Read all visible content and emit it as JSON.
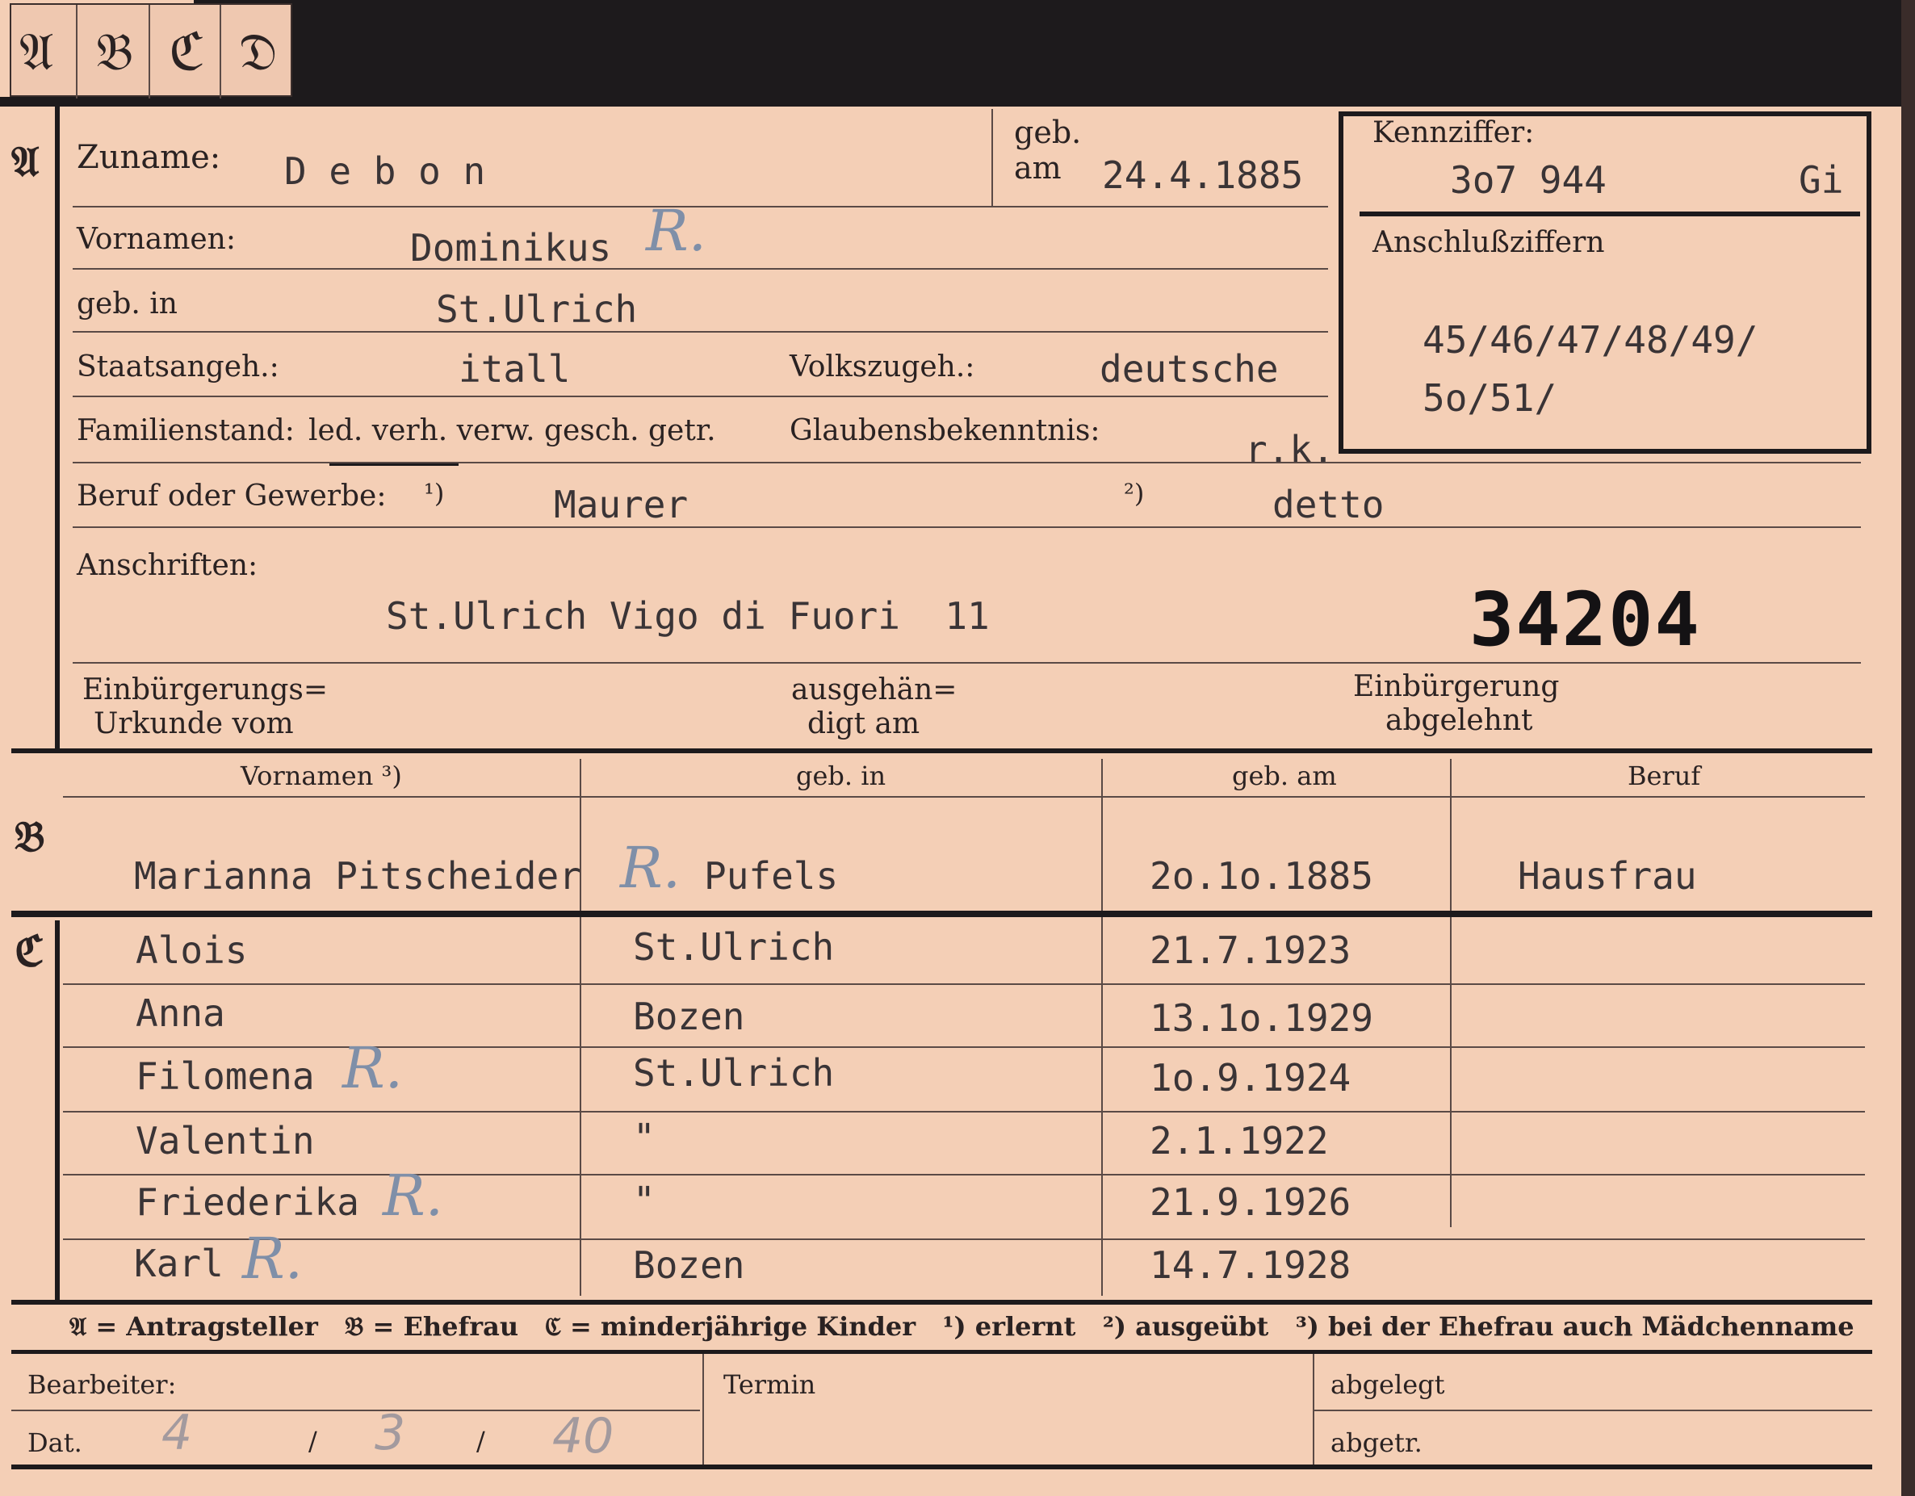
{
  "tabs": [
    "𝔄",
    "𝔅",
    "ℭ",
    "𝔇"
  ],
  "section_letters": {
    "a": "𝔄",
    "b": "𝔅",
    "c": "ℭ"
  },
  "section_a": {
    "surname_label": "Zuname:",
    "surname": "D e b o n",
    "born_label_1": "geb.",
    "born_label_2": "am",
    "birth_date": "24.4.1885",
    "given_names_label": "Vornamen:",
    "given_names": "Dominikus",
    "birthplace_label": "geb. in",
    "birthplace": "St.Ulrich",
    "citizenship_label": "Staatsangeh.:",
    "citizenship": "itall",
    "ethnicity_label": "Volkszugeh.:",
    "ethnicity": "deutsche",
    "marital_label": "Familienstand:",
    "marital_options": "led. verh. verw. gesch. getr.",
    "religion_label": "Glaubensbekenntnis:",
    "religion": "r.k.",
    "occupation_label": "Beruf oder Gewerbe:",
    "footnote_1": "¹)",
    "occupation_1": "Maurer",
    "footnote_2": "²)",
    "occupation_2": "detto",
    "address_label": "Anschriften:",
    "address": "St.Ulrich Vigo di Fuori  11",
    "stamp_number": "34204",
    "naturalization_label_1": "Einbürgerungs=",
    "naturalization_label_2": "Urkunde vom",
    "handed_label_1": "ausgehän=",
    "handed_label_2": "digt am",
    "rejected_label_1": "Einbürgerung",
    "rejected_label_2": "abgelehnt"
  },
  "id_box": {
    "label": "Kennziffer:",
    "number": "3o7 944",
    "suffix": "Gi",
    "connect_label": "Anschlußziffern",
    "connect_line_1": "45/46/47/48/49/",
    "connect_line_2": "5o/51/"
  },
  "r_mark": "R.",
  "family_headers": [
    "Vornamen ³)",
    "geb. in",
    "geb. am",
    "Beruf"
  ],
  "spouse": {
    "name": "Marianna Pitscheider",
    "place": "Pufels",
    "date": "2o.1o.1885",
    "job": "Hausfrau"
  },
  "children": [
    {
      "name": "Alois",
      "place": "St.Ulrich",
      "date": "21.7.1923"
    },
    {
      "name": "Anna",
      "place": "Bozen",
      "date": "13.1o.1929"
    },
    {
      "name": "Filomena",
      "place": "St.Ulrich",
      "date": "1o.9.1924"
    },
    {
      "name": "Valentin",
      "place": "\"",
      "date": "2.1.1922"
    },
    {
      "name": "Friederika",
      "place": "\"",
      "date": "21.9.1926"
    },
    {
      "name": "Karl",
      "place": "Bozen",
      "date": "14.7.1928"
    }
  ],
  "legend": "𝔄 = Antragsteller   𝔅 = Ehefrau   ℭ = minderjährige Kinder   ¹) erlernt   ²) ausgeübt   ³) bei der Ehefrau auch Mädchenname",
  "footer": {
    "clerk_label": "Bearbeiter:",
    "date_label": "Dat.",
    "date_d": "4",
    "date_sep1": "/",
    "date_m": "3",
    "date_sep2": "/",
    "date_y": "40",
    "deadline_label": "Termin",
    "filed_label": "abgelegt",
    "sent_label": "abgetr."
  }
}
